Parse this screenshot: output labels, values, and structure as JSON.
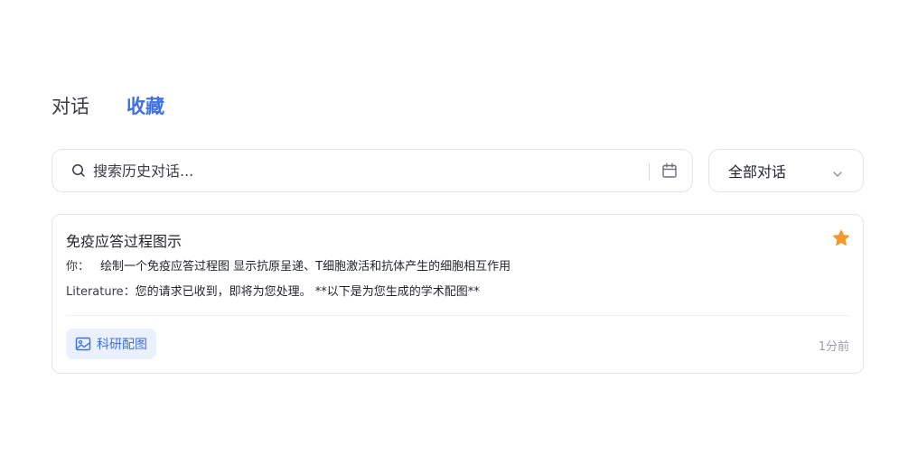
{
  "tabs": [
    {
      "label": "对话",
      "active": false
    },
    {
      "label": "收藏",
      "active": true
    }
  ],
  "search": {
    "placeholder": "搜索历史对话...",
    "value": ""
  },
  "filter": {
    "selected": "全部对话"
  },
  "conversation": {
    "title": "免疫应答过程图示",
    "starred": true,
    "user_prefix": "你：",
    "user_message": "绘制一个免疫应答过程图 显示抗原呈递、T细胞激活和抗体产生的细胞相互作用",
    "bot_prefix": "Literature：",
    "bot_message": "您的请求已收到，即将为您处理。 **以下是为您生成的学术配图**",
    "tag": "科研配图",
    "time": "1分前"
  },
  "colors": {
    "accent": "#3f6fe0",
    "star": "#f29a2e",
    "tag_bg": "#eaf0fc",
    "border": "#e3e5ea"
  },
  "icons": [
    "search-icon",
    "calendar-icon",
    "chevron-down-icon",
    "star-icon",
    "image-icon"
  ]
}
